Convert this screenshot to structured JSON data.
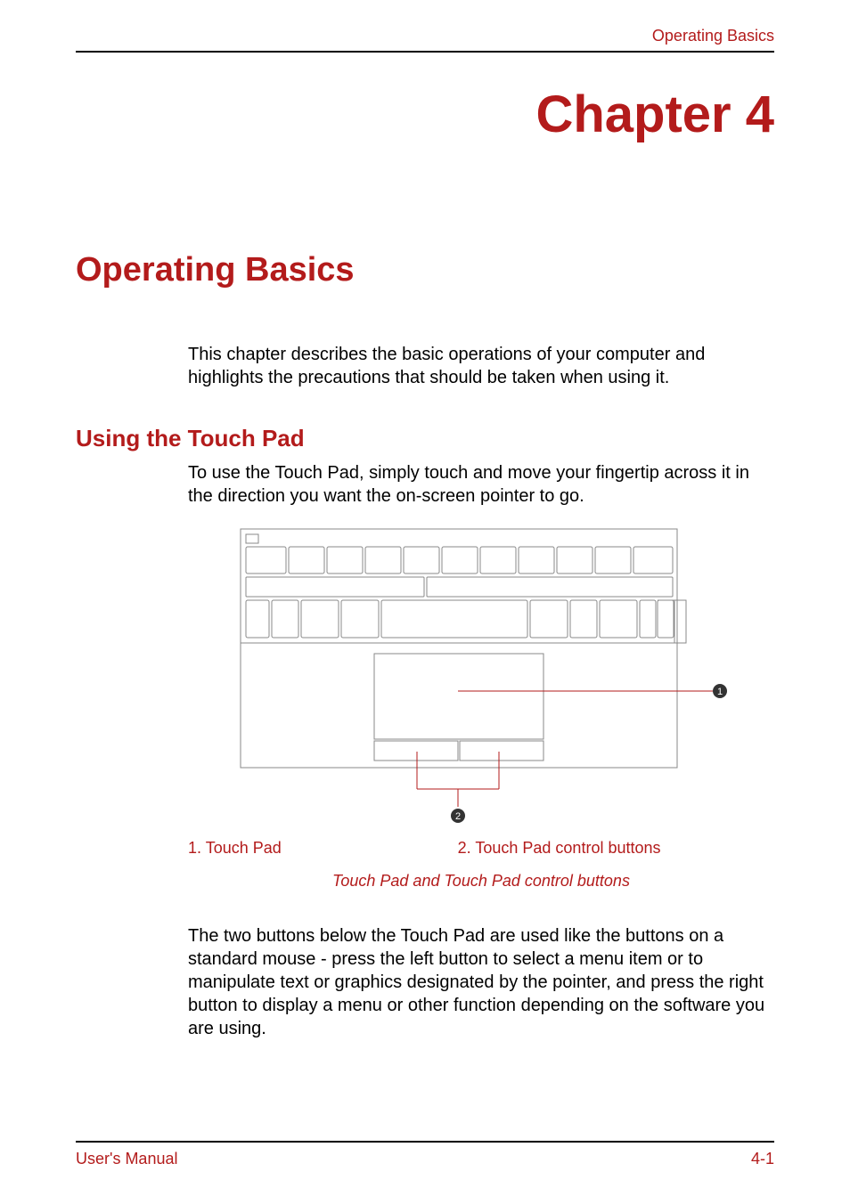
{
  "header": {
    "label": "Operating Basics"
  },
  "chapter": {
    "heading": "Chapter 4"
  },
  "section": {
    "title": "Operating Basics",
    "intro": "This chapter describes the basic operations of your computer and highlights the precautions that should be taken when using it."
  },
  "subsection": {
    "title": "Using the Touch Pad",
    "intro": "To use the Touch Pad, simply touch and move your fingertip across it in the direction you want the on-screen pointer to go.",
    "legend": {
      "item1": "1. Touch Pad",
      "item2": "2. Touch Pad control buttons"
    },
    "caption": "Touch Pad and Touch Pad control buttons",
    "body": "The two buttons below the Touch Pad are used like the buttons on a standard mouse - press the left button to select a menu item or to manipulate text or graphics designated by the pointer, and press the right button to display a menu or other function depending on the software you are using.",
    "callouts": {
      "one": "1",
      "two": "2"
    }
  },
  "footer": {
    "left": "User's Manual",
    "right": "4-1"
  }
}
